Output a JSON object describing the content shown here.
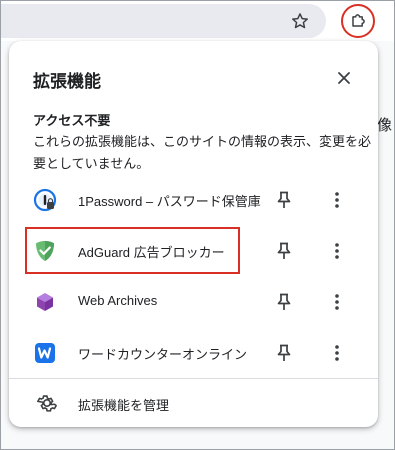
{
  "toolbar": {
    "bookmark_icon": "star-outline-icon",
    "extensions_icon": "puzzle-piece-icon",
    "accent_ring_color": "#d93025"
  },
  "page": {
    "edge_text": "像"
  },
  "popup": {
    "title": "拡張機能",
    "close_icon": "close-icon",
    "section": {
      "heading": "アクセス不要",
      "description": "これらの拡張機能は、このサイトの情報の表示、変更を必要としていません。"
    },
    "extensions": [
      {
        "name": "1Password – パスワード保管庫",
        "icon": "1password-icon",
        "highlighted": false
      },
      {
        "name": "AdGuard 広告ブロッカー",
        "icon": "adguard-shield-icon",
        "highlighted": true
      },
      {
        "name": "Web Archives",
        "icon": "web-archives-cube-icon",
        "highlighted": false
      },
      {
        "name": "ワードカウンターオンライン",
        "icon": "word-counter-w-icon",
        "highlighted": false
      }
    ],
    "manage_label": "拡張機能を管理",
    "highlight_color": "#d93025"
  }
}
